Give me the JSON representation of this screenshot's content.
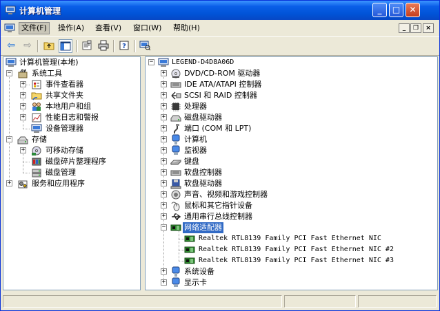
{
  "window": {
    "title": "计算机管理",
    "controls": {
      "minimize": "_",
      "maximize": "□",
      "close": "✕"
    }
  },
  "menubar": {
    "items": [
      {
        "label": "文件(F)"
      },
      {
        "label": "操作(A)"
      },
      {
        "label": "查看(V)"
      },
      {
        "label": "窗口(W)"
      },
      {
        "label": "帮助(H)"
      }
    ],
    "mdi": {
      "minimize": "_",
      "restore": "❐",
      "close": "×"
    }
  },
  "toolbar": {
    "back": "⇦",
    "forward": "⇨"
  },
  "left_tree": {
    "root": "计算机管理(本地)",
    "items": [
      {
        "label": "系统工具"
      },
      {
        "label": "事件查看器"
      },
      {
        "label": "共享文件夹"
      },
      {
        "label": "本地用户和组"
      },
      {
        "label": "性能日志和警报"
      },
      {
        "label": "设备管理器"
      },
      {
        "label": "存储"
      },
      {
        "label": "可移动存储"
      },
      {
        "label": "磁盘碎片整理程序"
      },
      {
        "label": "磁盘管理"
      },
      {
        "label": "服务和应用程序"
      }
    ]
  },
  "device_tree": {
    "root": "LEGEND-D4D8A06D",
    "categories": [
      {
        "label": "DVD/CD-ROM 驱动器"
      },
      {
        "label": "IDE ATA/ATAPI 控制器"
      },
      {
        "label": "SCSI 和 RAID 控制器"
      },
      {
        "label": "处理器"
      },
      {
        "label": "磁盘驱动器"
      },
      {
        "label": "端口 (COM 和 LPT)"
      },
      {
        "label": "计算机"
      },
      {
        "label": "监视器"
      },
      {
        "label": "键盘"
      },
      {
        "label": "软盘控制器"
      },
      {
        "label": "软盘驱动器"
      },
      {
        "label": "声音、视频和游戏控制器"
      },
      {
        "label": "鼠标和其它指针设备"
      },
      {
        "label": "通用串行总线控制器"
      },
      {
        "label": "网络适配器"
      },
      {
        "label": "系统设备"
      },
      {
        "label": "显示卡"
      }
    ],
    "network_adapters": [
      {
        "label": "Realtek RTL8139 Family PCI Fast Ethernet NIC"
      },
      {
        "label": "Realtek RTL8139 Family PCI Fast Ethernet NIC #2"
      },
      {
        "label": "Realtek RTL8139 Family PCI Fast Ethernet NIC #3"
      }
    ],
    "expand_symbols": {
      "plus": "+",
      "minus": "−"
    }
  },
  "colors": {
    "selection": "#316ac5",
    "titlebar": "#0053d6",
    "window_bg": "#ece9d8"
  }
}
